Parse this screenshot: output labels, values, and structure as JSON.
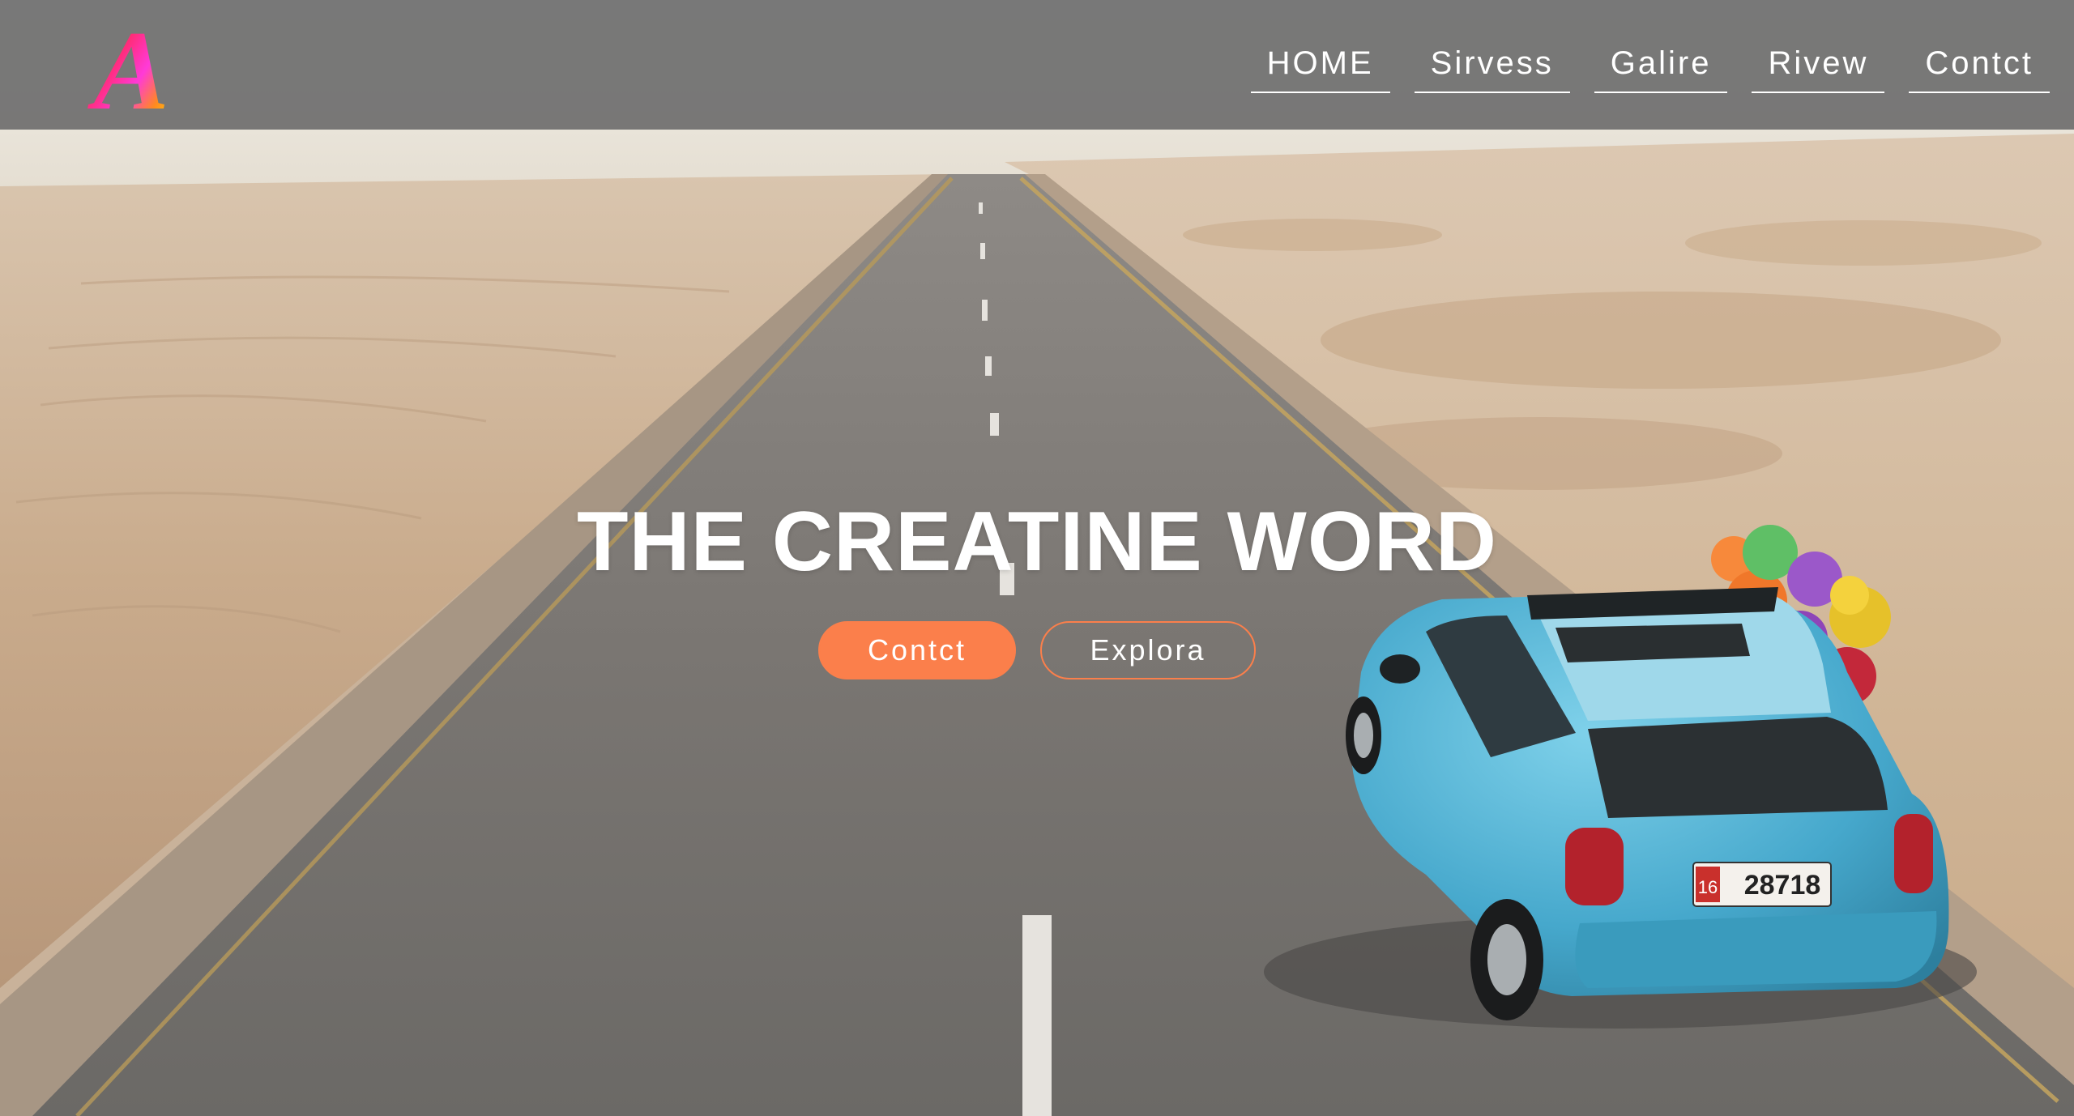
{
  "header": {
    "logo_letter": "A",
    "nav": [
      {
        "label": "HOME"
      },
      {
        "label": "Sirvess"
      },
      {
        "label": "Galire"
      },
      {
        "label": "Rivew"
      },
      {
        "label": "Contct"
      }
    ]
  },
  "hero": {
    "title": "THE CREATINE WORD",
    "primary_button": "Contct",
    "secondary_button": "Explora",
    "car_plate": "28718",
    "car_plate_code": "16"
  },
  "colors": {
    "accent": "#fb7f4b",
    "header_bg": "#6e6e6e",
    "car": "#4aa9c9"
  }
}
